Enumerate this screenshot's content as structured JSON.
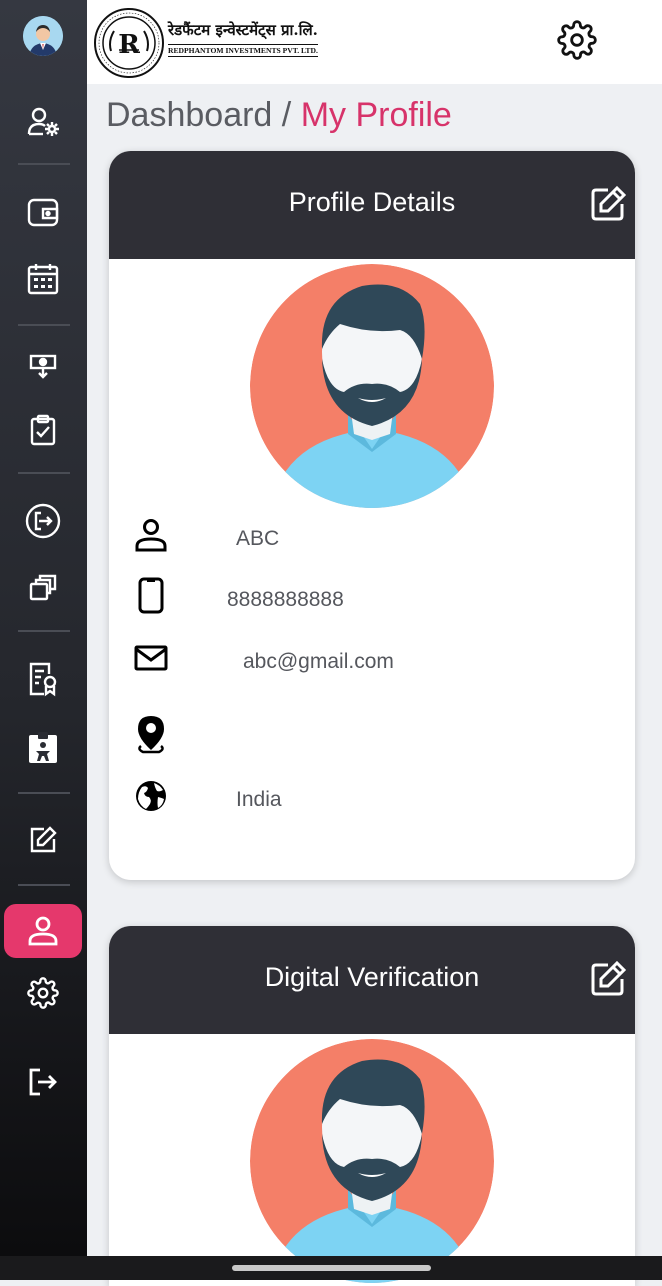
{
  "brand": {
    "name_hindi": "रेडफैंटम इन्वेस्टमेंट्स प्रा.लि.",
    "name_english": "REDPHANTOM INVESTMENTS PVT. LTD.",
    "seal_letter": "R"
  },
  "breadcrumb": {
    "root": "Dashboard",
    "separator": "/",
    "current": "My Profile"
  },
  "sidebar": {
    "items": [
      {
        "icon": "user-settings-icon"
      },
      {
        "icon": "wallet-icon"
      },
      {
        "icon": "calendar-icon"
      },
      {
        "icon": "money-icon"
      },
      {
        "icon": "clipboard-check-icon"
      },
      {
        "icon": "exit-circle-icon"
      },
      {
        "icon": "stack-icon"
      },
      {
        "icon": "certificate-icon"
      },
      {
        "icon": "id-badge-icon"
      },
      {
        "icon": "edit-icon"
      },
      {
        "icon": "profile-icon",
        "active": true
      },
      {
        "icon": "gear-icon"
      },
      {
        "icon": "logout-icon"
      }
    ],
    "active_color": "#e5386c"
  },
  "profile_card": {
    "title": "Profile Details",
    "name": "ABC",
    "phone": "8888888888",
    "email": "abc@gmail.com",
    "location": "",
    "country": "India"
  },
  "verification_card": {
    "title": "Digital Verification"
  },
  "colors": {
    "accent": "#d7336a",
    "card_header": "#2f2f36",
    "avatar_bg": "#f47f68",
    "shirt": "#7dd3f3"
  }
}
